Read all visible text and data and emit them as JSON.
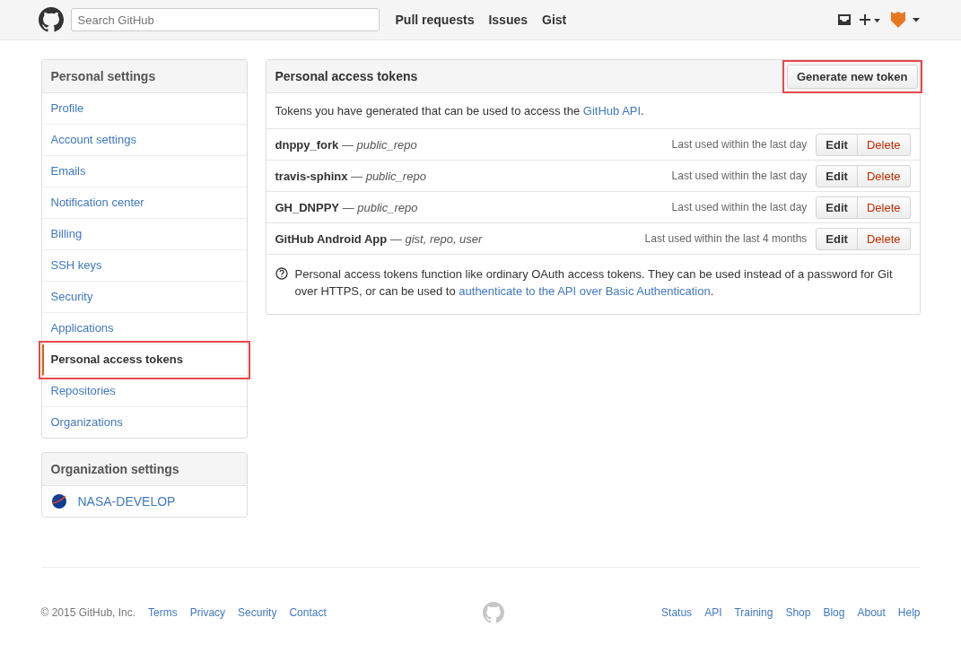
{
  "header": {
    "search": {
      "placeholder": "Search GitHub"
    },
    "nav": [
      "Pull requests",
      "Issues",
      "Gist"
    ]
  },
  "sidebar": {
    "title": "Personal settings",
    "items": [
      {
        "label": "Profile",
        "selected": false,
        "highlighted": false
      },
      {
        "label": "Account settings",
        "selected": false,
        "highlighted": false
      },
      {
        "label": "Emails",
        "selected": false,
        "highlighted": false
      },
      {
        "label": "Notification center",
        "selected": false,
        "highlighted": false
      },
      {
        "label": "Billing",
        "selected": false,
        "highlighted": false
      },
      {
        "label": "SSH keys",
        "selected": false,
        "highlighted": false
      },
      {
        "label": "Security",
        "selected": false,
        "highlighted": false
      },
      {
        "label": "Applications",
        "selected": false,
        "highlighted": false
      },
      {
        "label": "Personal access tokens",
        "selected": true,
        "highlighted": true
      },
      {
        "label": "Repositories",
        "selected": false,
        "highlighted": false
      },
      {
        "label": "Organizations",
        "selected": false,
        "highlighted": false
      }
    ]
  },
  "org_settings": {
    "title": "Organization settings",
    "items": [
      {
        "label": "NASA-DEVELOP"
      }
    ]
  },
  "panel": {
    "title": "Personal access tokens",
    "generate_button": {
      "label": "Generate new token",
      "highlighted": true
    },
    "intro": "Tokens you have generated that can be used to access the ",
    "intro_link": "GitHub API",
    "intro_end": ".",
    "tokens": [
      {
        "title": "**dnppy_fork** — *public_repo*",
        "last_used": "Last used within the last day",
        "edit": "Edit",
        "delete": "Delete"
      },
      {
        "title": "**travis-sphinx** — *public_repo*",
        "last_used": "Last used within the last day",
        "edit": "Edit",
        "delete": "Delete"
      },
      {
        "title": "**GH_DNPPY** — *public_repo*",
        "last_used": "Last used within the last day",
        "edit": "Edit",
        "delete": "Delete"
      },
      {
        "title": "**GitHub Android App** — *gist, repo, user*",
        "last_used": "Last used within the last 4 months",
        "edit": "Edit",
        "delete": "Delete"
      }
    ],
    "note": "Personal access tokens function like ordinary OAuth access tokens. They can be used instead of a password for Git over HTTPS, or can be used to ",
    "note_link": "authenticate to the API over Basic Authentication",
    "note_end": "."
  },
  "footer": {
    "copyright": "© 2015 GitHub, Inc.",
    "left_links": [
      "Terms",
      "Privacy",
      "Security",
      "Contact"
    ],
    "right_links": [
      "Status",
      "API",
      "Training",
      "Shop",
      "Blog",
      "About",
      "Help"
    ]
  }
}
